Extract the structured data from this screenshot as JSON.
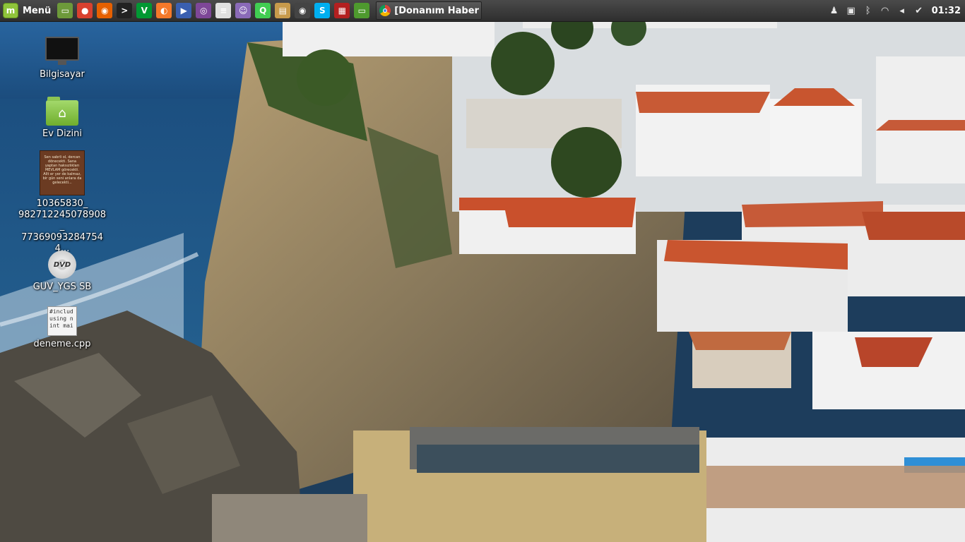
{
  "panel": {
    "menu_label": "Menü",
    "launchers": [
      {
        "name": "show-desktop-icon",
        "color": "#6d9a3a",
        "glyph": "▭"
      },
      {
        "name": "chrome-icon",
        "color": "#d8412f",
        "glyph": "●"
      },
      {
        "name": "firefox-icon",
        "color": "#e66000",
        "glyph": "◉"
      },
      {
        "name": "terminal-icon",
        "color": "#222222",
        "glyph": ">"
      },
      {
        "name": "vim-icon",
        "color": "#019833",
        "glyph": "V"
      },
      {
        "name": "blender-icon",
        "color": "#f5792a",
        "glyph": "◐"
      },
      {
        "name": "video-player-icon",
        "color": "#3a5fb0",
        "glyph": "▶"
      },
      {
        "name": "tor-icon",
        "color": "#7e4798",
        "glyph": "◎"
      },
      {
        "name": "text-editor-icon",
        "color": "#e0e0e0",
        "glyph": "≡"
      },
      {
        "name": "pidgin-icon",
        "color": "#8a6ab8",
        "glyph": "☺"
      },
      {
        "name": "qt-creator-icon",
        "color": "#41cd52",
        "glyph": "Q"
      },
      {
        "name": "archive-manager-icon",
        "color": "#c79a4b",
        "glyph": "▤"
      },
      {
        "name": "webcam-icon",
        "color": "#444444",
        "glyph": "◉"
      },
      {
        "name": "skype-icon",
        "color": "#00aff0",
        "glyph": "S"
      },
      {
        "name": "calculator-icon",
        "color": "#b32020",
        "glyph": "▦"
      },
      {
        "name": "workspace-icon",
        "color": "#4e9a2e",
        "glyph": "▭"
      }
    ],
    "task_title": "[Donanım Haber ...",
    "tray": [
      {
        "name": "user-icon",
        "glyph": "♟"
      },
      {
        "name": "lock-icon",
        "glyph": "▣"
      },
      {
        "name": "bluetooth-icon",
        "glyph": "ᛒ"
      },
      {
        "name": "wifi-icon",
        "glyph": "◠"
      },
      {
        "name": "volume-icon",
        "glyph": "◂"
      },
      {
        "name": "update-shield-icon",
        "glyph": "✔"
      }
    ],
    "clock": "01:32"
  },
  "desktop": {
    "computer_label": "Bilgisayar",
    "home_label": "Ev Dizini",
    "image_label": "10365830_\n982712245078908_\n773690932847544...",
    "image_thumb_text": "Sen sabrli ol, dercan dönecekti. Sana yaptan haksızlıkları MEVLAM görecekti. Allt er yer de kalmaz, bir gün seni anlara da gelecekti...",
    "dvd_label": "GUV_YGS SB",
    "dvd_text": "DVD",
    "cpp_label": "deneme.cpp",
    "cpp_preview": "#includ\nusing n\nint mai"
  }
}
